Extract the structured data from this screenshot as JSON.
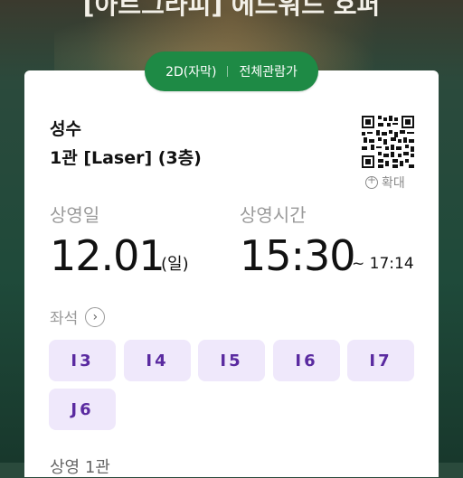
{
  "movie": {
    "title": "[아트그라피] 에드워드 호퍼"
  },
  "format": {
    "type": "2D(자막)",
    "rating": "전체관람가"
  },
  "theater": {
    "name": "성수",
    "hall": "1관 [Laser] (3층)"
  },
  "qr": {
    "zoom_label": "확대"
  },
  "date": {
    "label": "상영일",
    "value": "12.01",
    "day": "(일)"
  },
  "time": {
    "label": "상영시간",
    "start": "15:30",
    "end": "~ 17:14"
  },
  "seats": {
    "label": "좌석",
    "items": [
      "I3",
      "I4",
      "I5",
      "I6",
      "I7",
      "J6"
    ]
  },
  "next_section": {
    "label": "상영 1관"
  },
  "colors": {
    "accent_green": "#1e8a45",
    "seat_bg": "#efe8fb",
    "seat_text": "#5a2aa0"
  }
}
